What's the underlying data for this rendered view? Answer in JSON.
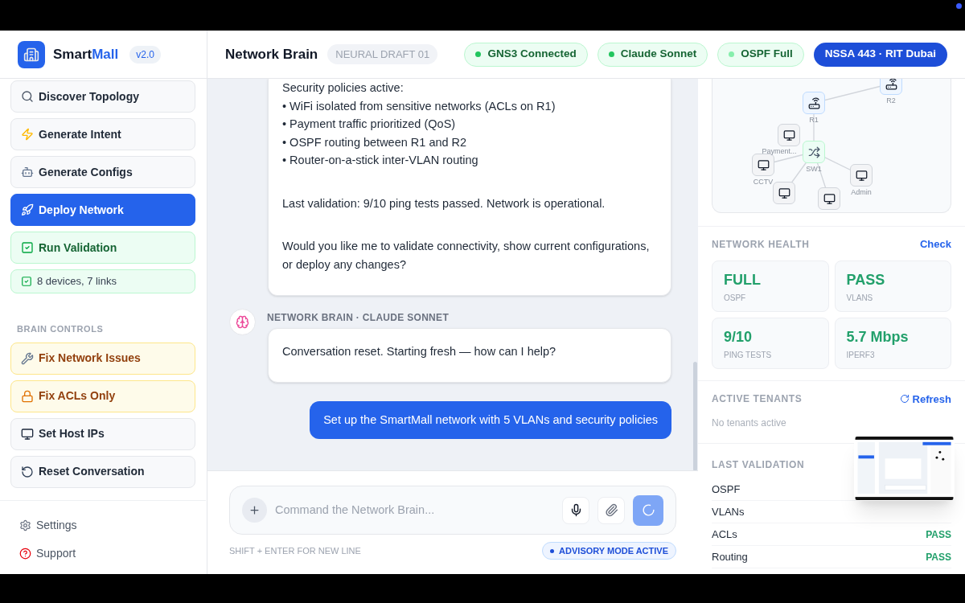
{
  "brand": {
    "name_main": "Smart",
    "name_accent": "Mall",
    "version": "v2.0"
  },
  "header": {
    "title": "Network Brain",
    "badge": "NEURAL DRAFT 01",
    "pills": [
      {
        "label": "GNS3 Connected",
        "kind": "status",
        "active": true
      },
      {
        "label": "Claude Sonnet",
        "kind": "status",
        "active": true
      },
      {
        "label": "OSPF Full",
        "kind": "status",
        "active": false
      },
      {
        "label": "NSSA 443 · RIT Dubai",
        "kind": "course"
      }
    ]
  },
  "sidebar": {
    "actions": [
      {
        "label": "Discover Topology",
        "kind": "default"
      },
      {
        "label": "Generate Intent",
        "kind": "default"
      },
      {
        "label": "Generate Configs",
        "kind": "default"
      },
      {
        "label": "Deploy Network",
        "kind": "primary"
      },
      {
        "label": "Run Validation",
        "kind": "success"
      },
      {
        "label": "8 devices, 7 links",
        "kind": "status"
      }
    ],
    "section_title": "BRAIN CONTROLS",
    "controls": [
      {
        "label": "Fix Network Issues",
        "kind": "warning"
      },
      {
        "label": "Fix ACLs Only",
        "kind": "warning"
      },
      {
        "label": "Set Host IPs",
        "kind": "default"
      },
      {
        "label": "Reset Conversation",
        "kind": "default"
      }
    ],
    "footer": [
      {
        "label": "Settings"
      },
      {
        "label": "Support"
      }
    ]
  },
  "chat": {
    "messages": [
      {
        "kind": "assistant",
        "show_header": false,
        "paragraphs": [
          [
            "Security policies active:",
            "• WiFi isolated from sensitive networks (ACLs on R1)",
            "• Payment traffic prioritized (QoS)",
            "• OSPF routing between R1 and R2",
            "• Router-on-a-stick inter-VLAN routing"
          ],
          [
            "Last validation: 9/10 ping tests passed. Network is operational."
          ],
          [
            "Would you like me to validate connectivity, show current configurations, or deploy any changes?"
          ]
        ]
      },
      {
        "kind": "assistant",
        "show_header": true,
        "sender": "NETWORK BRAIN · CLAUDE SONNET",
        "paragraphs": [
          [
            "Conversation reset. Starting fresh — how can I help?"
          ]
        ]
      },
      {
        "kind": "user",
        "text": "Set up the SmartMall network with 5 VLANs and security policies"
      }
    ],
    "input": {
      "placeholder": "Command the Network Brain...",
      "sending": true
    },
    "hint": "SHIFT + ENTER FOR NEW LINE",
    "mode_badge": "ADVISORY MODE ACTIVE"
  },
  "topology": {
    "nodes": [
      {
        "label": "R2",
        "kind": "router"
      },
      {
        "label": "R1",
        "kind": "router"
      },
      {
        "label": "Payment...",
        "kind": "host"
      },
      {
        "label": "SW1",
        "kind": "switch"
      },
      {
        "label": "CCTV",
        "kind": "host"
      },
      {
        "kind": "host"
      },
      {
        "kind": "host"
      },
      {
        "label": "Admin",
        "kind": "host"
      }
    ]
  },
  "health": {
    "title": "NETWORK HEALTH",
    "action": "Check",
    "cards": [
      {
        "value": "FULL",
        "label": "OSPF"
      },
      {
        "value": "PASS",
        "label": "VLANS"
      },
      {
        "value": "9/10",
        "label": "PING TESTS"
      },
      {
        "value": "5.7 Mbps",
        "label": "IPERF3"
      }
    ]
  },
  "tenants": {
    "title": "ACTIVE TENANTS",
    "action": "Refresh",
    "empty": "No tenants active"
  },
  "validation": {
    "title": "LAST VALIDATION",
    "rows": [
      {
        "label": "OSPF"
      },
      {
        "label": "VLANs"
      },
      {
        "label": "ACLs",
        "result": "PASS"
      },
      {
        "label": "Routing",
        "result": "PASS"
      }
    ]
  }
}
